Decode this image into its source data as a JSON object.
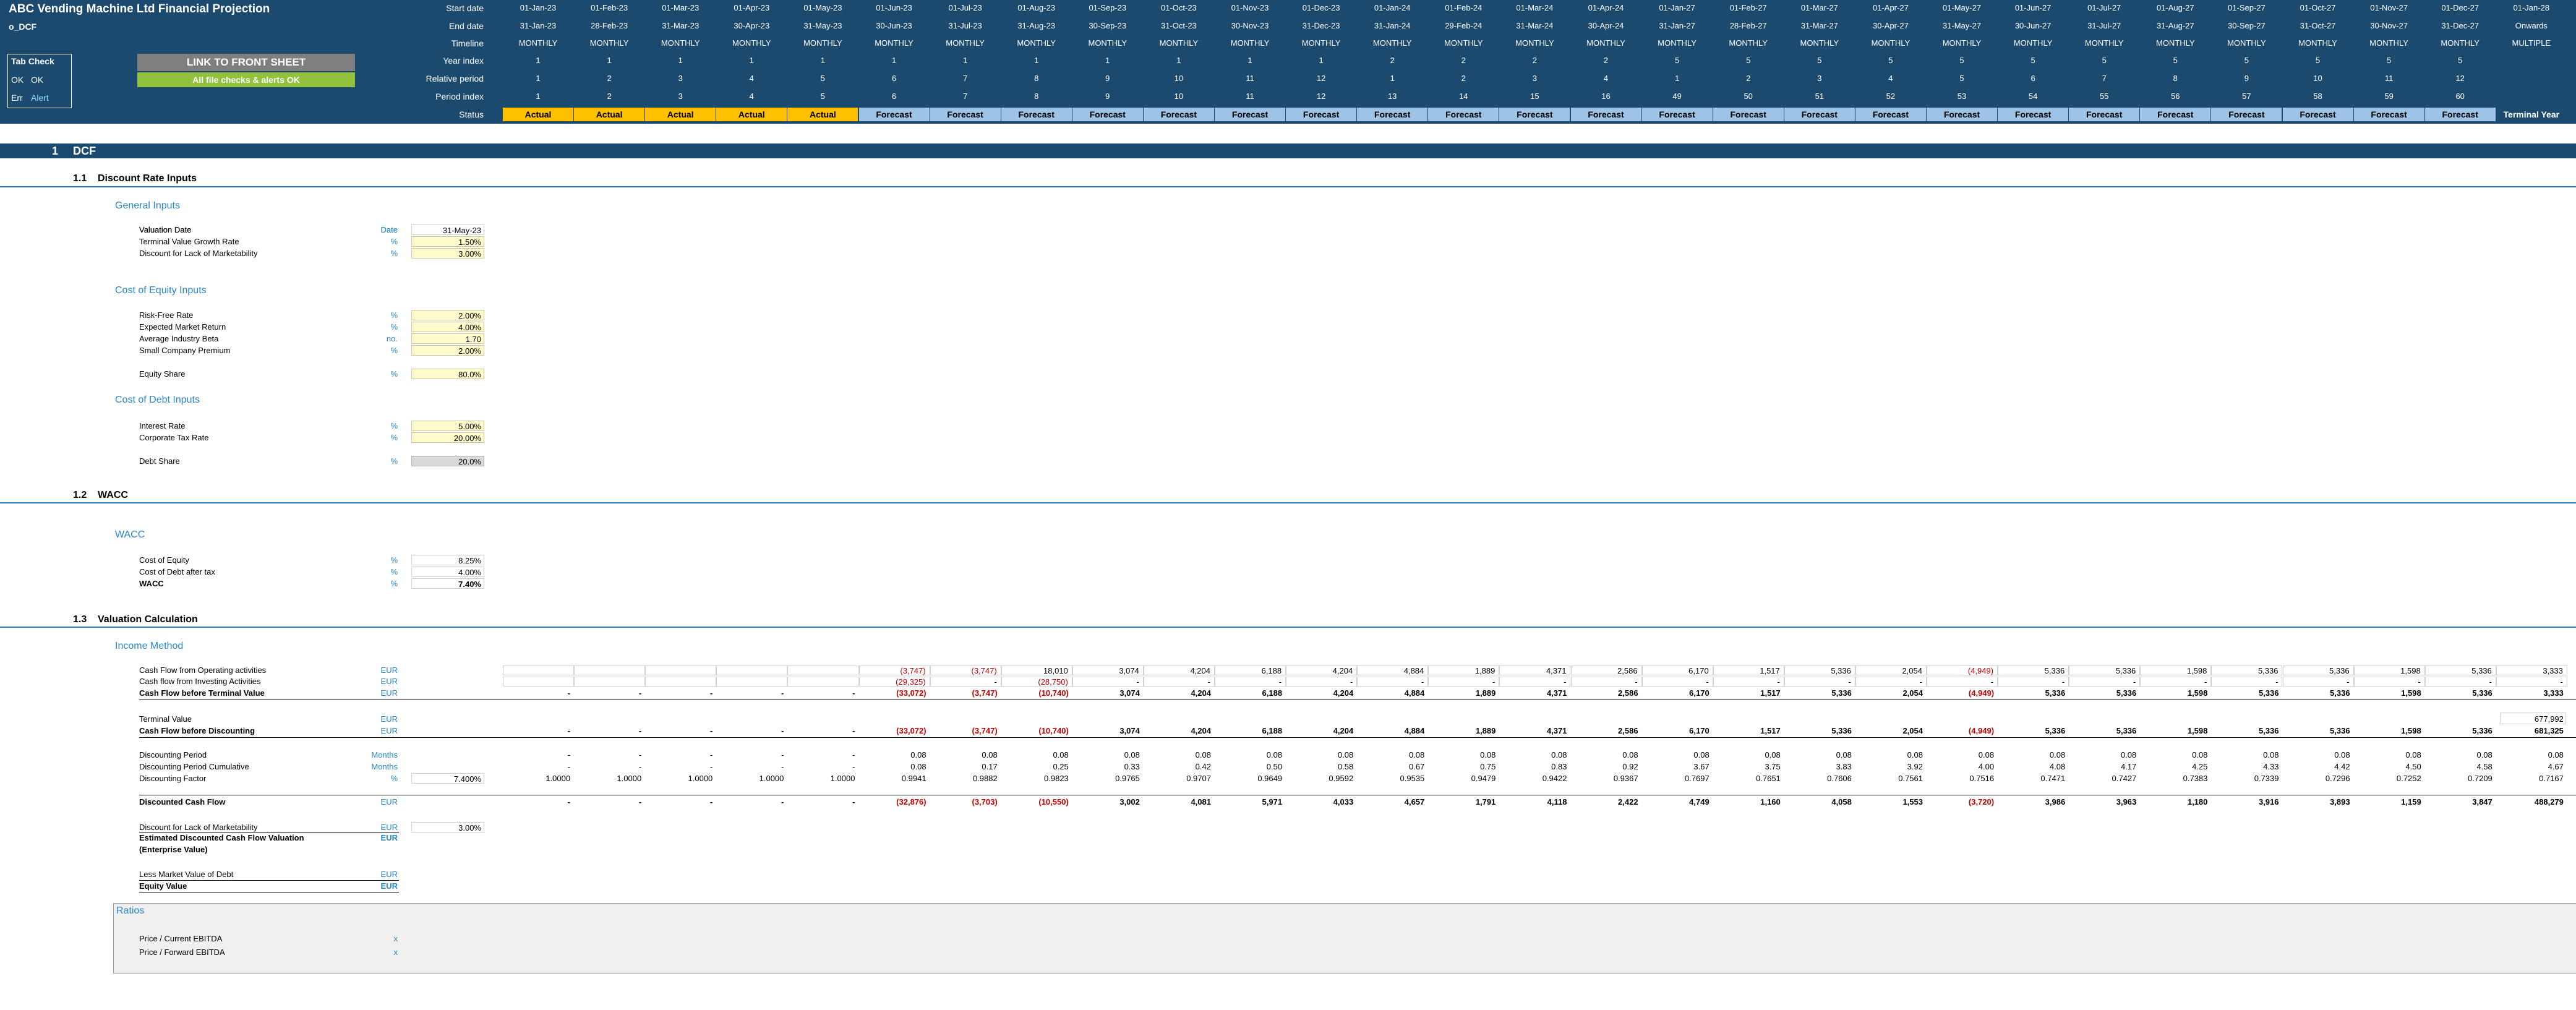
{
  "header": {
    "title": "ABC Vending Machine Ltd Financial Projection",
    "sheet": "o_DCF",
    "tab_check": {
      "title": "Tab Check",
      "ok_code": "OK",
      "ok_label": "OK",
      "err_code": "Err",
      "err_label": "Alert"
    },
    "link_button": "LINK TO FRONT SHEET",
    "checks_ok": "All file checks & alerts OK",
    "row_labels": [
      "Start date",
      "End date",
      "Timeline",
      "Year index",
      "Relative period",
      "Period index",
      "Status"
    ]
  },
  "timeline": {
    "start_dates": [
      "01-Jan-23",
      "01-Feb-23",
      "01-Mar-23",
      "01-Apr-23",
      "01-May-23",
      "01-Jun-23",
      "01-Jul-23",
      "01-Aug-23",
      "01-Sep-23",
      "01-Oct-23",
      "01-Nov-23",
      "01-Dec-23",
      "01-Jan-24",
      "01-Feb-24",
      "01-Mar-24",
      "01-Apr-24",
      "01-Jan-27",
      "01-Feb-27",
      "01-Mar-27",
      "01-Apr-27",
      "01-May-27",
      "01-Jun-27",
      "01-Jul-27",
      "01-Aug-27",
      "01-Sep-27",
      "01-Oct-27",
      "01-Nov-27",
      "01-Dec-27",
      "01-Jan-28"
    ],
    "end_dates": [
      "31-Jan-23",
      "28-Feb-23",
      "31-Mar-23",
      "30-Apr-23",
      "31-May-23",
      "30-Jun-23",
      "31-Jul-23",
      "31-Aug-23",
      "30-Sep-23",
      "31-Oct-23",
      "30-Nov-23",
      "31-Dec-23",
      "31-Jan-24",
      "29-Feb-24",
      "31-Mar-24",
      "30-Apr-24",
      "31-Jan-27",
      "28-Feb-27",
      "31-Mar-27",
      "30-Apr-27",
      "31-May-27",
      "30-Jun-27",
      "31-Jul-27",
      "31-Aug-27",
      "30-Sep-27",
      "31-Oct-27",
      "30-Nov-27",
      "31-Dec-27",
      "Onwards"
    ],
    "timeline": [
      "MONTHLY",
      "MONTHLY",
      "MONTHLY",
      "MONTHLY",
      "MONTHLY",
      "MONTHLY",
      "MONTHLY",
      "MONTHLY",
      "MONTHLY",
      "MONTHLY",
      "MONTHLY",
      "MONTHLY",
      "MONTHLY",
      "MONTHLY",
      "MONTHLY",
      "MONTHLY",
      "MONTHLY",
      "MONTHLY",
      "MONTHLY",
      "MONTHLY",
      "MONTHLY",
      "MONTHLY",
      "MONTHLY",
      "MONTHLY",
      "MONTHLY",
      "MONTHLY",
      "MONTHLY",
      "MONTHLY",
      "MULTIPLE"
    ],
    "year_index": [
      "1",
      "1",
      "1",
      "1",
      "1",
      "1",
      "1",
      "1",
      "1",
      "1",
      "1",
      "1",
      "2",
      "2",
      "2",
      "2",
      "5",
      "5",
      "5",
      "5",
      "5",
      "5",
      "5",
      "5",
      "5",
      "5",
      "5",
      "5",
      ""
    ],
    "relative_period": [
      "1",
      "2",
      "3",
      "4",
      "5",
      "6",
      "7",
      "8",
      "9",
      "10",
      "11",
      "12",
      "1",
      "2",
      "3",
      "4",
      "1",
      "2",
      "3",
      "4",
      "5",
      "6",
      "7",
      "8",
      "9",
      "10",
      "11",
      "12",
      ""
    ],
    "period_index": [
      "1",
      "2",
      "3",
      "4",
      "5",
      "6",
      "7",
      "8",
      "9",
      "10",
      "11",
      "12",
      "13",
      "14",
      "15",
      "16",
      "49",
      "50",
      "51",
      "52",
      "53",
      "54",
      "55",
      "56",
      "57",
      "58",
      "59",
      "60",
      ""
    ],
    "status": [
      "Actual",
      "Actual",
      "Actual",
      "Actual",
      "Actual",
      "Forecast",
      "Forecast",
      "Forecast",
      "Forecast",
      "Forecast",
      "Forecast",
      "Forecast",
      "Forecast",
      "Forecast",
      "Forecast",
      "Forecast",
      "Forecast",
      "Forecast",
      "Forecast",
      "Forecast",
      "Forecast",
      "Forecast",
      "Forecast",
      "Forecast",
      "Forecast",
      "Forecast",
      "Forecast",
      "Forecast",
      "Terminal Year"
    ]
  },
  "section": {
    "num": "1",
    "title": "DCF"
  },
  "sub_1_1": {
    "num": "1.1",
    "title": "Discount Rate Inputs",
    "general_title": "General Inputs",
    "general_rows": [
      {
        "label": "Valuation Date",
        "unit": "Date",
        "value": "31-May-23"
      },
      {
        "label": "Terminal Value Growth Rate",
        "unit": "%",
        "value": "1.50%"
      },
      {
        "label": "Discount for Lack of Marketability",
        "unit": "%",
        "value": "3.00%"
      }
    ],
    "coe_title": "Cost of Equity Inputs",
    "coe_rows": [
      {
        "label": "Risk-Free Rate",
        "unit": "%",
        "value": "2.00%"
      },
      {
        "label": "Expected Market Return",
        "unit": "%",
        "value": "4.00%"
      },
      {
        "label": "Average Industry Beta",
        "unit": "no.",
        "value": "1.70"
      },
      {
        "label": "Small Company Premium",
        "unit": "%",
        "value": "2.00%"
      }
    ],
    "equity_share": {
      "label": "Equity Share",
      "unit": "%",
      "value": "80.0%"
    },
    "cod_title": "Cost of Debt Inputs",
    "cod_rows": [
      {
        "label": "Interest Rate",
        "unit": "%",
        "value": "5.00%"
      },
      {
        "label": "Corporate Tax Rate",
        "unit": "%",
        "value": "20.00%"
      }
    ],
    "debt_share": {
      "label": "Debt Share",
      "unit": "%",
      "value": "20.0%"
    }
  },
  "sub_1_2": {
    "num": "1.2",
    "title": "WACC",
    "block_title": "WACC",
    "rows": [
      {
        "label": "Cost of Equity",
        "unit": "%",
        "value": "8.25%"
      },
      {
        "label": "Cost of Debt after tax",
        "unit": "%",
        "value": "4.00%"
      },
      {
        "label": "WACC",
        "unit": "%",
        "value": "7.40%"
      }
    ]
  },
  "sub_1_3": {
    "num": "1.3",
    "title": "Valuation Calculation",
    "income_title": "Income Method",
    "rows": {
      "cfo": {
        "label": "Cash Flow from Operating activities",
        "unit": "EUR",
        "values": [
          "",
          "",
          "",
          "",
          "",
          "(3,747)",
          "(3,747)",
          "18,010",
          "3,074",
          "4,204",
          "6,188",
          "4,204",
          "4,884",
          "1,889",
          "4,371",
          "2,586",
          "6,170",
          "1,517",
          "5,336",
          "2,054",
          "(4,949)",
          "5,336",
          "5,336",
          "1,598",
          "5,336",
          "5,336",
          "1,598",
          "5,336",
          "3,333"
        ]
      },
      "cfi": {
        "label": "Cash flow from Investing Activities",
        "unit": "EUR",
        "values": [
          "",
          "",
          "",
          "",
          "",
          "(29,325)",
          "-",
          "(28,750)",
          "-",
          "-",
          "-",
          "-",
          "-",
          "-",
          "-",
          "-",
          "-",
          "-",
          "-",
          "-",
          "-",
          "-",
          "-",
          "-",
          "-",
          "-",
          "-",
          "-",
          "-"
        ]
      },
      "cfbtv": {
        "label": "Cash Flow before Terminal Value",
        "unit": "EUR",
        "values": [
          "-",
          "-",
          "-",
          "-",
          "-",
          "(33,072)",
          "(3,747)",
          "(10,740)",
          "3,074",
          "4,204",
          "6,188",
          "4,204",
          "4,884",
          "1,889",
          "4,371",
          "2,586",
          "6,170",
          "1,517",
          "5,336",
          "2,054",
          "(4,949)",
          "5,336",
          "5,336",
          "1,598",
          "5,336",
          "5,336",
          "1,598",
          "5,336",
          "3,333"
        ]
      },
      "tv": {
        "label": "Terminal Value",
        "unit": "EUR",
        "values": [
          "",
          "",
          "",
          "",
          "",
          "",
          "",
          "",
          "",
          "",
          "",
          "",
          "",
          "",
          "",
          "",
          "",
          "",
          "",
          "",
          "",
          "",
          "",
          "",
          "",
          "",
          "",
          "",
          "677,992"
        ]
      },
      "cfbd": {
        "label": "Cash Flow before Discounting",
        "unit": "EUR",
        "values": [
          "-",
          "-",
          "-",
          "-",
          "-",
          "(33,072)",
          "(3,747)",
          "(10,740)",
          "3,074",
          "4,204",
          "6,188",
          "4,204",
          "4,884",
          "1,889",
          "4,371",
          "2,586",
          "6,170",
          "1,517",
          "5,336",
          "2,054",
          "(4,949)",
          "5,336",
          "5,336",
          "1,598",
          "5,336",
          "5,336",
          "1,598",
          "5,336",
          "681,325"
        ]
      },
      "dp": {
        "label": "Discounting Period",
        "unit": "Months",
        "values": [
          "-",
          "-",
          "-",
          "-",
          "-",
          "0.08",
          "0.08",
          "0.08",
          "0.08",
          "0.08",
          "0.08",
          "0.08",
          "0.08",
          "0.08",
          "0.08",
          "0.08",
          "0.08",
          "0.08",
          "0.08",
          "0.08",
          "0.08",
          "0.08",
          "0.08",
          "0.08",
          "0.08",
          "0.08",
          "0.08",
          "0.08",
          "0.08"
        ]
      },
      "dpc": {
        "label": "Discounting Period Cumulative",
        "unit": "Months",
        "values": [
          "-",
          "-",
          "-",
          "-",
          "-",
          "0.08",
          "0.17",
          "0.25",
          "0.33",
          "0.42",
          "0.50",
          "0.58",
          "0.67",
          "0.75",
          "0.83",
          "0.92",
          "3.67",
          "3.75",
          "3.83",
          "3.92",
          "4.00",
          "4.08",
          "4.17",
          "4.25",
          "4.33",
          "4.42",
          "4.50",
          "4.58",
          "4.67"
        ]
      },
      "df": {
        "label": "Discounting Factor",
        "unit": "%",
        "rate": "7.400%",
        "values": [
          "1.0000",
          "1.0000",
          "1.0000",
          "1.0000",
          "1.0000",
          "0.9941",
          "0.9882",
          "0.9823",
          "0.9765",
          "0.9707",
          "0.9649",
          "0.9592",
          "0.9535",
          "0.9479",
          "0.9422",
          "0.9367",
          "0.7697",
          "0.7651",
          "0.7606",
          "0.7561",
          "0.7516",
          "0.7471",
          "0.7427",
          "0.7383",
          "0.7339",
          "0.7296",
          "0.7252",
          "0.7209",
          "0.7167"
        ]
      },
      "dcf": {
        "label": "Discounted Cash Flow",
        "unit": "EUR",
        "values": [
          "-",
          "-",
          "-",
          "-",
          "-",
          "(32,876)",
          "(3,703)",
          "(10,550)",
          "3,002",
          "4,081",
          "5,971",
          "4,033",
          "4,657",
          "1,791",
          "4,118",
          "2,422",
          "4,749",
          "1,160",
          "4,058",
          "1,553",
          "(3,720)",
          "3,986",
          "3,963",
          "1,180",
          "3,916",
          "3,893",
          "1,159",
          "3,847",
          "488,279"
        ]
      }
    },
    "dlom": {
      "label": "Discount for Lack of Marketability",
      "unit": "EUR",
      "value": "3.00%"
    },
    "edcf_label_1": "Estimated Discounted Cash Flow Valuation",
    "edcf_label_2": "(Enterprise Value)",
    "edcf_unit": "EUR",
    "debt": {
      "label": "Less Market Value of Debt",
      "unit": "EUR"
    },
    "equity": {
      "label": "Equity Value",
      "unit": "EUR"
    }
  },
  "ratios": {
    "title": "Ratios",
    "rows": [
      {
        "label": "Price / Current EBITDA",
        "unit": "x"
      },
      {
        "label": "Price / Forward EBITDA",
        "unit": "x"
      }
    ]
  },
  "colors": {
    "header_bg": "#1c4a6e",
    "actual": "#ffc000",
    "forecast": "#9dc3e6",
    "link_button": "#7f7f7f",
    "checks_ok": "#92c13e",
    "blue_text": "#2a86c6",
    "negative": "#c00000",
    "input_yellow": "#fffbcc"
  }
}
